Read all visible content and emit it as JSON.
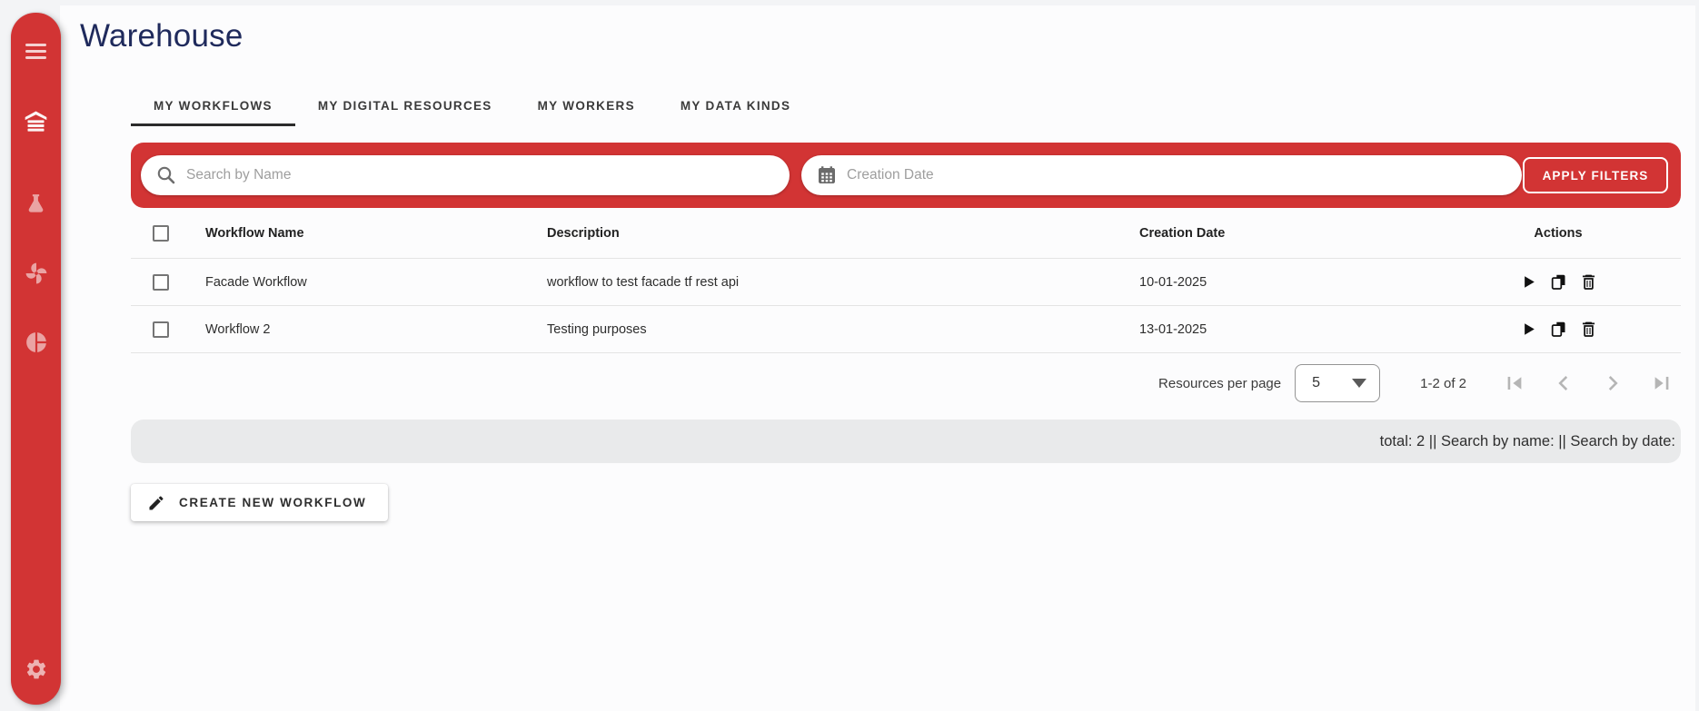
{
  "app": {
    "title": "Warehouse"
  },
  "colors": {
    "accent_red": "#d23434",
    "title_navy": "#1f2a5c",
    "status_bar_bg": "#e9eaeb"
  },
  "sidebar": {
    "items": [
      {
        "icon": "hamburger-icon"
      },
      {
        "icon": "warehouse-icon",
        "active": true
      },
      {
        "icon": "flask-icon"
      },
      {
        "icon": "fan-icon"
      },
      {
        "icon": "pie-chart-icon"
      },
      {
        "icon": "gear-icon"
      }
    ]
  },
  "tabs": {
    "items": [
      {
        "label": "MY WORKFLOWS",
        "active": true
      },
      {
        "label": "MY DIGITAL RESOURCES",
        "active": false
      },
      {
        "label": "MY WORKERS",
        "active": false
      },
      {
        "label": "MY DATA KINDS",
        "active": false
      }
    ]
  },
  "filters": {
    "search_placeholder": "Search by Name",
    "date_placeholder": "Creation Date",
    "apply_label": "APPLY FILTERS"
  },
  "table": {
    "columns": [
      "Workflow Name",
      "Description",
      "Creation Date",
      "Actions"
    ],
    "rows": [
      {
        "name": "Facade Workflow",
        "description": "workflow to test facade tf rest api",
        "creation_date": "10-01-2025"
      },
      {
        "name": "Workflow 2",
        "description": "Testing purposes",
        "creation_date": "13-01-2025"
      }
    ],
    "row_actions": [
      "run-icon",
      "copy-icon",
      "delete-icon"
    ]
  },
  "pagination": {
    "per_page_label": "Resources per page",
    "page_size": "5",
    "range_label": "1-2 of 2",
    "controls": [
      "first-page-icon",
      "previous-page-icon",
      "next-page-icon",
      "last-page-icon"
    ]
  },
  "status_bar": {
    "text": "total: 2 || Search by name: || Search by date:"
  },
  "create": {
    "label": "CREATE NEW WORKFLOW"
  }
}
